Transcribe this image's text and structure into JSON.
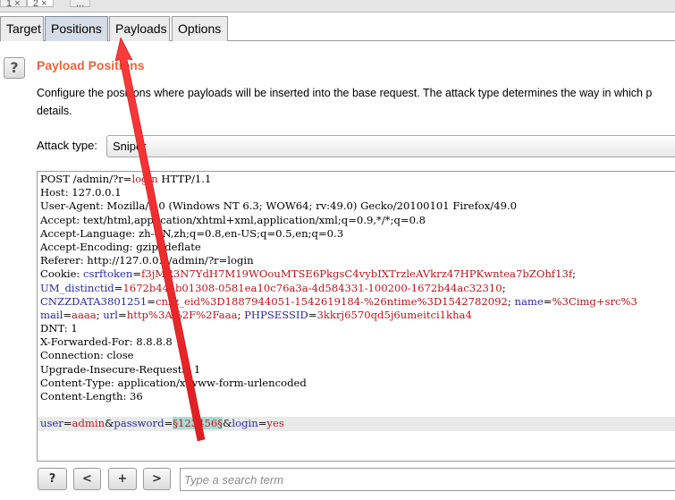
{
  "outer_tabs": [
    "1 ×",
    "2 ×",
    "..."
  ],
  "tabs": [
    {
      "label": "Target",
      "active": false
    },
    {
      "label": "Positions",
      "active": true
    },
    {
      "label": "Payloads",
      "active": false
    },
    {
      "label": "Options",
      "active": false
    }
  ],
  "help_label": "?",
  "section_title": "Payload Positions",
  "description_line1": "Configure the positions where payloads will be inserted into the base request. The attack type determines the way in which p",
  "description_line2": "details.",
  "attack_type_label": "Attack type:",
  "attack_type_value": "Sniper",
  "request_lines": [
    "POST /admin/?r=login HTTP/1.1",
    "Host: 127.0.0.1",
    "User-Agent: Mozilla/5.0 (Windows NT 6.3; WOW64; rv:49.0) Gecko/20100101 Firefox/49.0",
    "Accept: text/html,application/xhtml+xml,application/xml;q=0.9,*/*;q=0.8",
    "Accept-Language: zh-CN,zh;q=0.8,en-US;q=0.5,en;q=0.3",
    "Accept-Encoding: gzip, deflate",
    "Referer: http://127.0.0.1/admin/?r=login",
    "Cookie: csrftoken=f3jMR3N7YdH7M19WOouMTSE6PkgsC4vybIXTrzleAVkrz47HPKwntea7bZOhf13f;",
    "UM_distinctid=1672b44ab01308-0581ea10c76a3a-4d584331-100200-1672b44ac32310;",
    "CNZZDATA3801251=cnzz_eid%3D1887944051-1542619184-%26ntime%3D1542782092; name=%3Cimg+src%3",
    "mail=aaaa; url=http%3A%2F%2Faaa; PHPSESSID=3kkrj6570qd5j6umeitci1kha4",
    "DNT: 1",
    "X-Forwarded-For: 8.8.8.8",
    "Connection: close",
    "Upgrade-Insecure-Requests: 1",
    "Content-Type: application/x-www-form-urlencoded",
    "Content-Length: 36",
    "",
    "user=admin&password=§123456§&login=yes"
  ],
  "buttons": {
    "help": "?",
    "prev": "<",
    "add": "+",
    "next": ">"
  },
  "search": {
    "placeholder": "Type a search term",
    "value": ""
  },
  "colors": {
    "accent_title": "#e8663a",
    "param_name": "#2a2aa6",
    "param_value": "#c0141c",
    "payload_marker_bg": "#a7dcd4",
    "arrow": "#e8262a"
  }
}
